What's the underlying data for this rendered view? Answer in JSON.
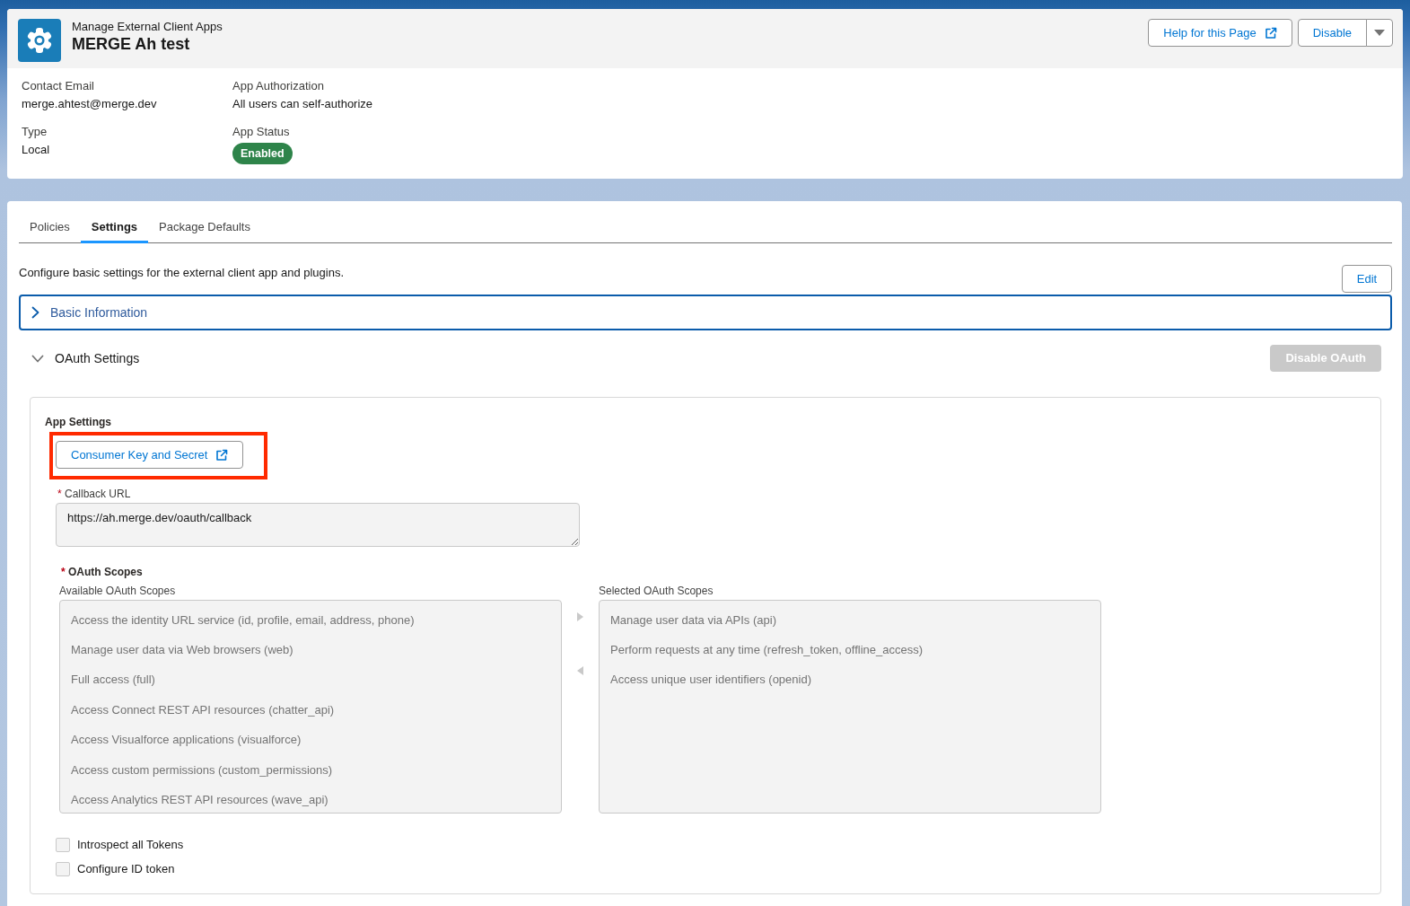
{
  "header": {
    "object_type": "Manage External Client Apps",
    "title": "MERGE Ah test",
    "actions": [
      {
        "kind": "external_link",
        "label": "Help for this Page"
      },
      {
        "kind": "split",
        "label": "Disable"
      }
    ]
  },
  "details": [
    {
      "kind": "text",
      "label": "Contact Email",
      "value": "merge.ahtest@merge.dev"
    },
    {
      "kind": "text",
      "label": "App Authorization",
      "value": "All users can self-authorize"
    },
    {
      "kind": "text",
      "label": "Type",
      "value": "Local"
    },
    {
      "kind": "badge",
      "label": "App Status",
      "value": "Enabled"
    }
  ],
  "tabs": [
    {
      "label": "Policies",
      "selected": false
    },
    {
      "label": "Settings",
      "selected": true
    },
    {
      "label": "Package Defaults",
      "selected": false
    }
  ],
  "settings": {
    "description": "Configure basic settings for the external client app and plugins.",
    "edit_button": "Edit",
    "sections": [
      {
        "title": "Basic Information",
        "expanded": false,
        "focused": true
      },
      {
        "title": "OAuth Settings",
        "expanded": true,
        "focused": false,
        "action": {
          "label": "Disable OAuth",
          "disabled": true
        },
        "panel": {
          "group_title": "App Settings",
          "consumer_button": {
            "label": "Consumer Key and Secret",
            "highlighted": true
          },
          "callback_url": {
            "required_mark": "*",
            "label": "Callback URL",
            "value": "https://ah.merge.dev/oauth/callback"
          },
          "scopes": {
            "required_mark": "*",
            "label": "OAuth Scopes",
            "available": {
              "label": "Available OAuth Scopes",
              "items": [
                {
                  "label": "Access the identity URL service (id, profile, email, address, phone)",
                  "selected": false
                },
                {
                  "label": "Manage user data via Web browsers (web)",
                  "selected": false
                },
                {
                  "label": "Full access (full)",
                  "selected": false
                },
                {
                  "label": "Access Connect REST API resources (chatter_api)",
                  "selected": false
                },
                {
                  "label": "Access Visualforce applications (visualforce)",
                  "selected": false
                },
                {
                  "label": "Access custom permissions (custom_permissions)",
                  "selected": false
                },
                {
                  "label": "Access Analytics REST API resources (wave_api)",
                  "selected": false
                }
              ]
            },
            "selected": {
              "label": "Selected OAuth Scopes",
              "items": [
                {
                  "label": "Manage user data via APIs (api)",
                  "selected": false
                },
                {
                  "label": "Perform requests at any time (refresh_token, offline_access)",
                  "selected": false
                },
                {
                  "label": "Access unique user identifiers (openid)",
                  "selected": false
                }
              ]
            }
          },
          "options": [
            {
              "label": "Introspect all Tokens",
              "checked": false
            },
            {
              "label": "Configure ID token",
              "checked": false
            }
          ]
        }
      }
    ]
  }
}
